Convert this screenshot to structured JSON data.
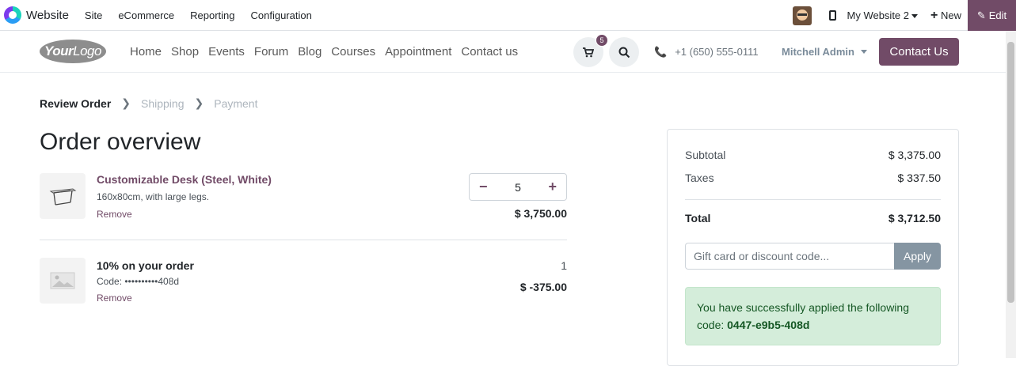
{
  "topbar": {
    "app_name": "Website",
    "menu": [
      "Site",
      "eCommerce",
      "Reporting",
      "Configuration"
    ],
    "website_selector": "My Website 2",
    "new_label": "New",
    "edit_label": "Edit"
  },
  "header": {
    "logo_text_bold": "Your",
    "logo_text": "Logo",
    "nav": [
      "Home",
      "Shop",
      "Events",
      "Forum",
      "Blog",
      "Courses",
      "Appointment",
      "Contact us"
    ],
    "cart_count": "5",
    "phone": "+1 (650) 555-0111",
    "user": "Mitchell Admin",
    "contact_button": "Contact Us"
  },
  "steps": [
    "Review Order",
    "Shipping",
    "Payment"
  ],
  "page_title": "Order overview",
  "items": [
    {
      "name": "Customizable Desk (Steel, White)",
      "description": "160x80cm, with large legs.",
      "remove": "Remove",
      "quantity": "5",
      "price": "$ 3,750.00"
    },
    {
      "name": "10% on your order",
      "description": "Code: ••••••••••408d",
      "remove": "Remove",
      "quantity": "1",
      "price": "$ -375.00"
    }
  ],
  "summary": {
    "subtotal_label": "Subtotal",
    "subtotal": "$ 3,375.00",
    "taxes_label": "Taxes",
    "taxes": "$ 337.50",
    "total_label": "Total",
    "total": "$ 3,712.50",
    "coupon_placeholder": "Gift card or discount code...",
    "apply_label": "Apply",
    "alert_text": "You have successfully applied the following code:",
    "alert_code": "0447-e9b5-408d"
  },
  "colors": {
    "brand": "#714b67",
    "success_bg": "#d4edda",
    "success_text": "#155724"
  }
}
